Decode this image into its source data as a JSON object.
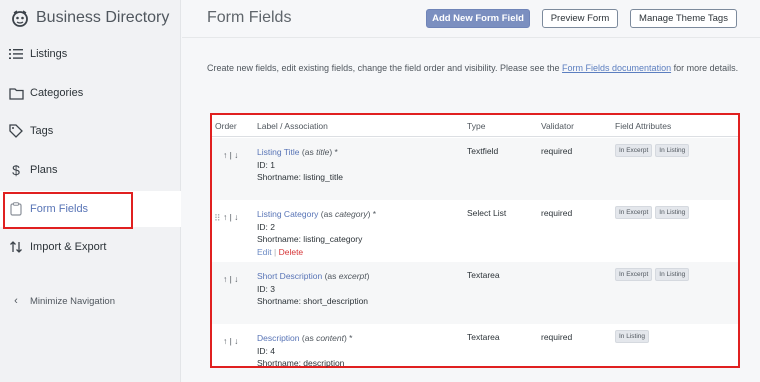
{
  "sidebar": {
    "brand": "Business Directory",
    "items": [
      {
        "label": "Listings",
        "icon": "list-icon"
      },
      {
        "label": "Categories",
        "icon": "folder-icon"
      },
      {
        "label": "Tags",
        "icon": "tag-icon"
      },
      {
        "label": "Plans",
        "icon": "dollar-icon"
      },
      {
        "label": "Form Fields",
        "icon": "clipboard-icon"
      },
      {
        "label": "Import & Export",
        "icon": "import-export-icon"
      }
    ],
    "minimize": "Minimize Navigation"
  },
  "header": {
    "title": "Form Fields",
    "add_button": "Add New Form Field",
    "preview_button": "Preview Form",
    "theme_button": "Manage Theme Tags"
  },
  "description": {
    "before": "Create new fields, edit existing fields, change the field order and visibility. Please see the ",
    "link": "Form Fields documentation",
    "after": " for more details."
  },
  "table": {
    "columns": [
      "Order",
      "Label / Association",
      "Type",
      "Validator",
      "Field Attributes"
    ],
    "order_arrows": "↑ | ↓",
    "rows": [
      {
        "label": "Listing Title",
        "assoc_prefix": "(as ",
        "assoc": "title",
        "assoc_suffix": ")",
        "req": " *",
        "id": "ID: 1",
        "shortname": "Shortname: listing_title",
        "type": "Textfield",
        "validator": "required",
        "attrs": [
          "In Excerpt",
          "In Listing"
        ]
      },
      {
        "label": "Listing Category",
        "assoc_prefix": "(as ",
        "assoc": "category",
        "assoc_suffix": ")",
        "req": " *",
        "id": "ID: 2",
        "shortname": "Shortname: listing_category",
        "type": "Select List",
        "validator": "required",
        "attrs": [
          "In Excerpt",
          "In Listing"
        ],
        "edit": "Edit",
        "sep": " | ",
        "delete": "Delete"
      },
      {
        "label": "Short Description",
        "assoc_prefix": "(as ",
        "assoc": "excerpt",
        "assoc_suffix": ")",
        "req": "",
        "id": "ID: 3",
        "shortname": "Shortname: short_description",
        "type": "Textarea",
        "validator": "",
        "attrs": [
          "In Excerpt",
          "In Listing"
        ]
      },
      {
        "label": "Description",
        "assoc_prefix": "(as ",
        "assoc": "content",
        "assoc_suffix": ")",
        "req": " *",
        "id": "ID: 4",
        "shortname": "Shortname: description",
        "type": "Textarea",
        "validator": "required",
        "attrs": [
          "In Listing"
        ]
      }
    ]
  },
  "colors": {
    "accent": "#5874b6",
    "highlight": "#e02020",
    "delete": "#d63638"
  }
}
